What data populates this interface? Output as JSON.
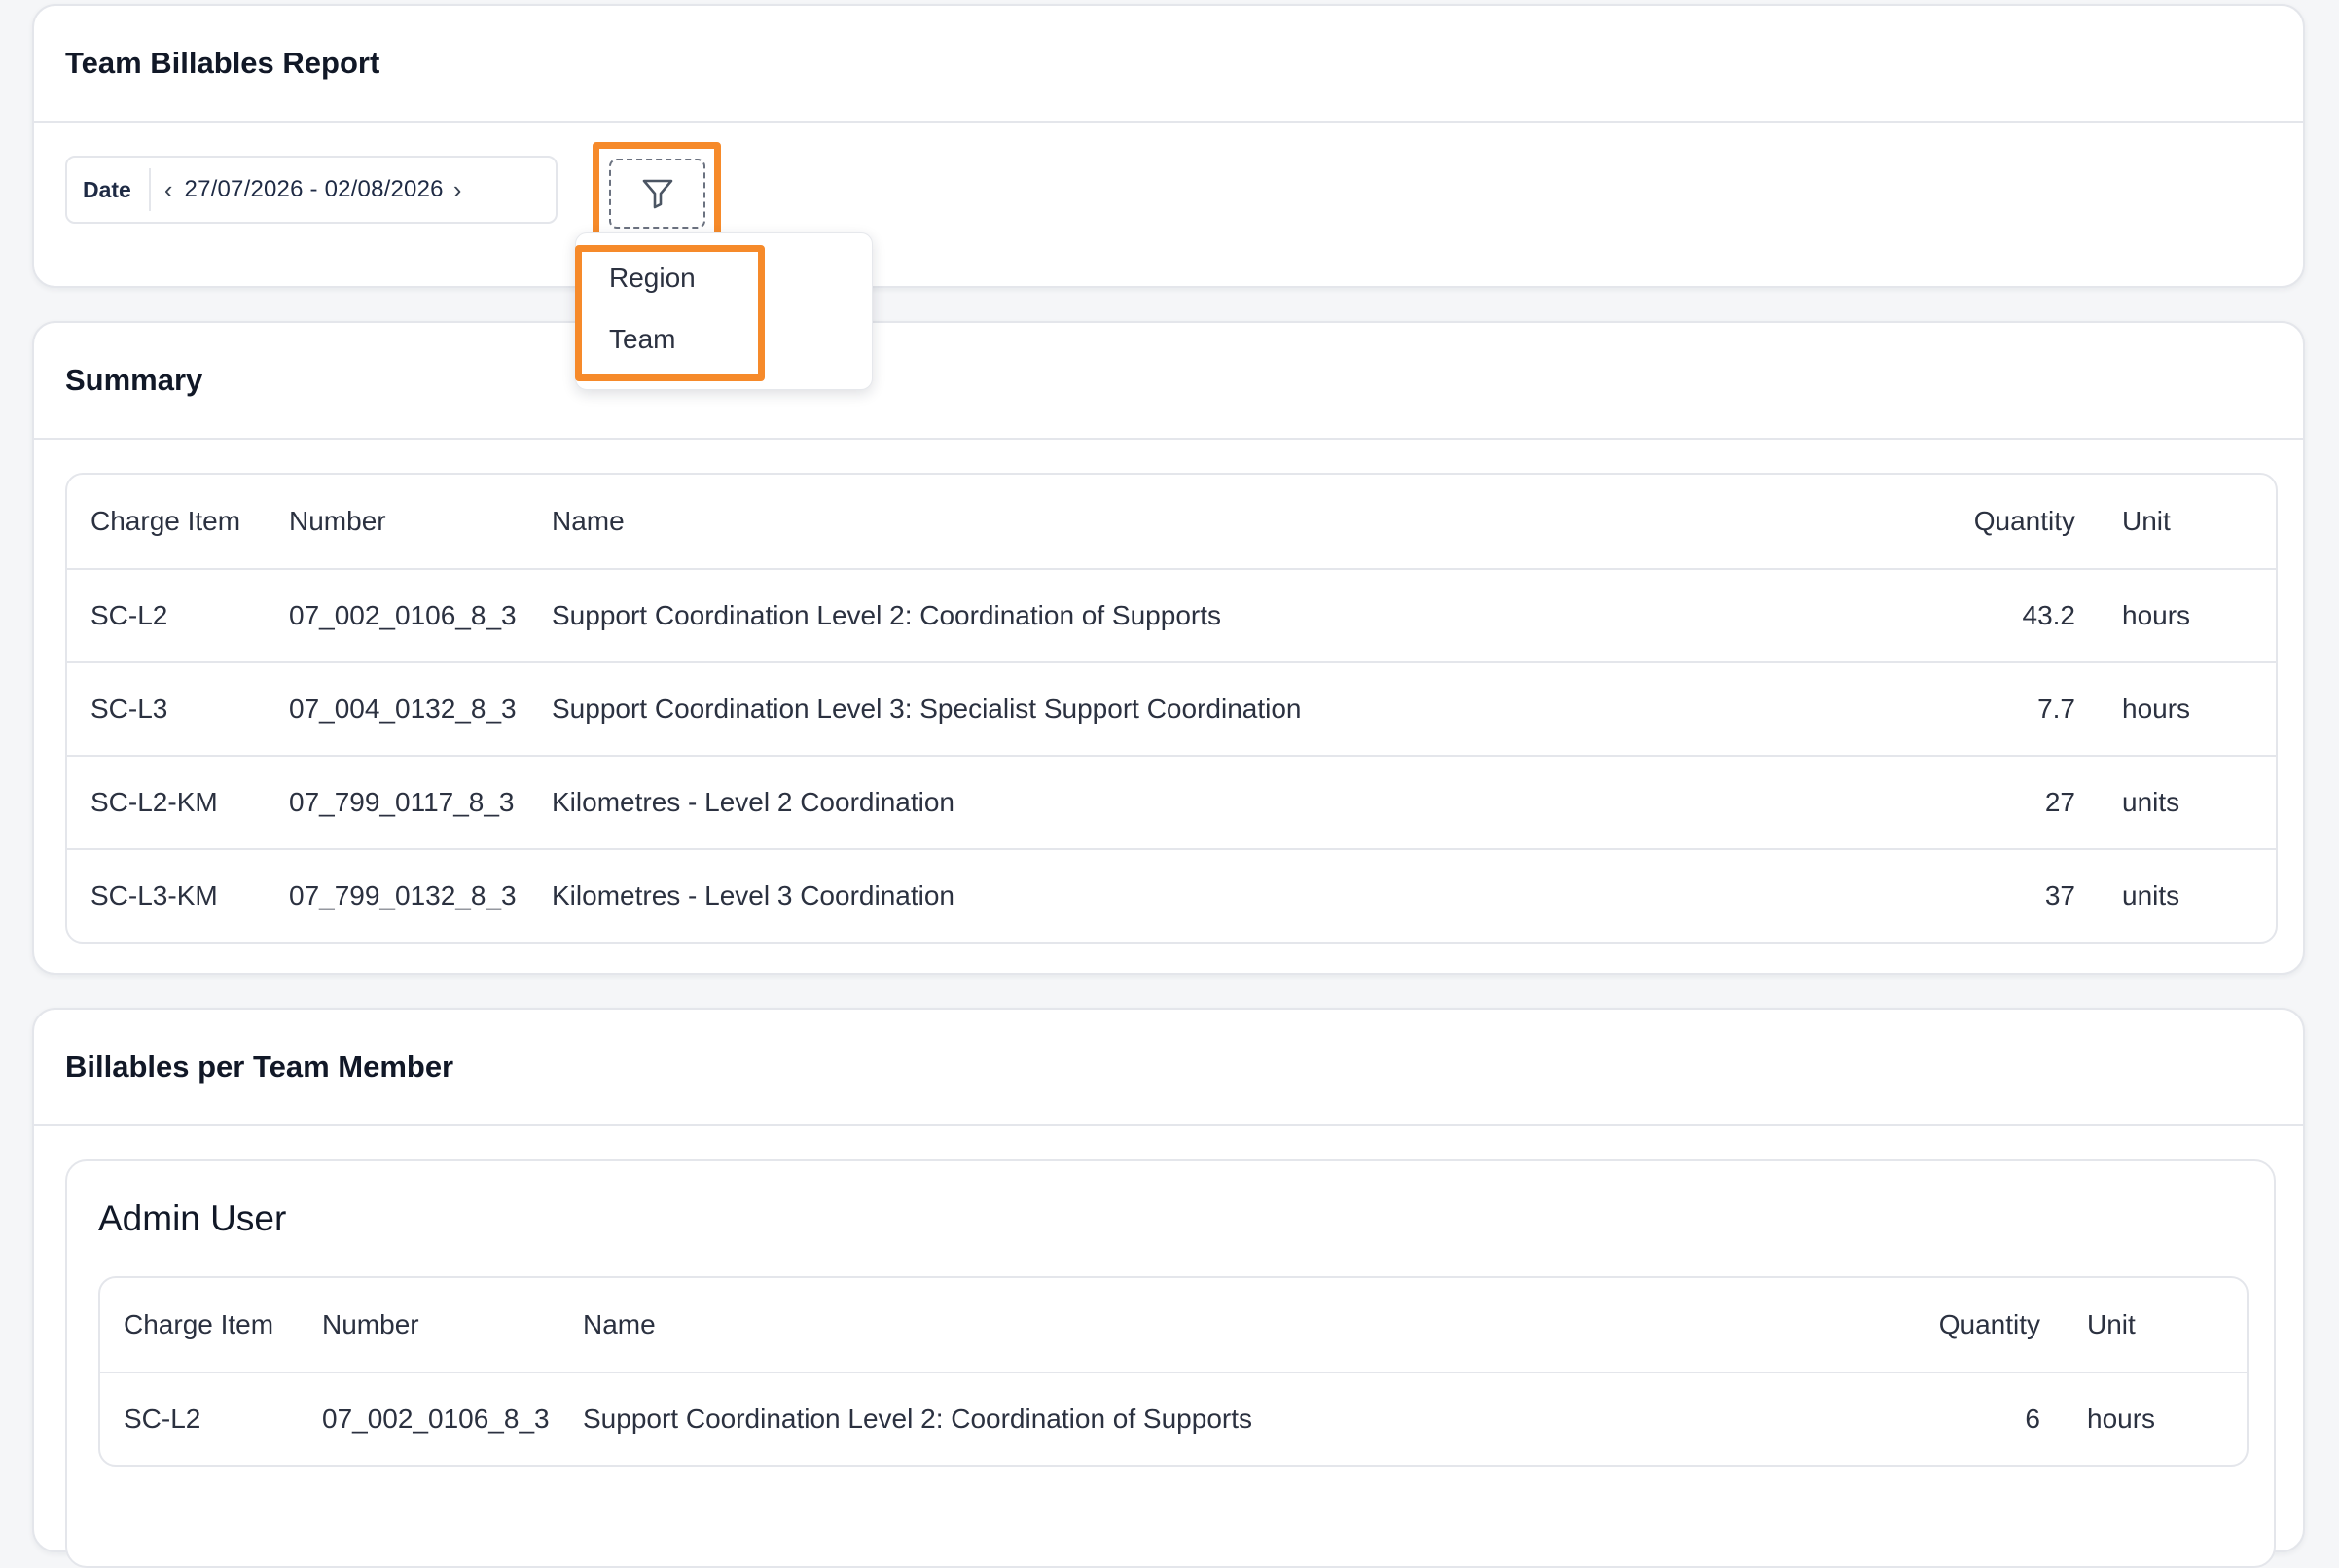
{
  "report": {
    "title": "Team Billables Report",
    "date_label": "Date",
    "date_range": "27/07/2026 - 02/08/2026",
    "filter_menu": [
      "Region",
      "Team"
    ]
  },
  "summary": {
    "title": "Summary",
    "columns": [
      "Charge Item",
      "Number",
      "Name",
      "Quantity",
      "Unit"
    ],
    "rows": [
      [
        "SC-L2",
        "07_002_0106_8_3",
        "Support Coordination Level 2: Coordination of Supports",
        "43.2",
        "hours"
      ],
      [
        "SC-L3",
        "07_004_0132_8_3",
        "Support Coordination Level 3: Specialist Support Coordination",
        "7.7",
        "hours"
      ],
      [
        "SC-L2-KM",
        "07_799_0117_8_3",
        "Kilometres - Level 2 Coordination",
        "27",
        "units"
      ],
      [
        "SC-L3-KM",
        "07_799_0132_8_3",
        "Kilometres - Level 3 Coordination",
        "37",
        "units"
      ]
    ]
  },
  "members": {
    "title": "Billables per Team Member",
    "list": [
      {
        "name": "Admin User",
        "columns": [
          "Charge Item",
          "Number",
          "Name",
          "Quantity",
          "Unit"
        ],
        "rows": [
          [
            "SC-L2",
            "07_002_0106_8_3",
            "Support Coordination Level 2: Coordination of Supports",
            "6",
            "hours"
          ]
        ]
      }
    ]
  },
  "colors": {
    "highlight": "#f68a2a",
    "border": "#e4e6eb",
    "background": "#f5f6f8"
  },
  "icons": {
    "filter": "filter-icon",
    "prev": "chevron-left-icon",
    "next": "chevron-right-icon"
  }
}
